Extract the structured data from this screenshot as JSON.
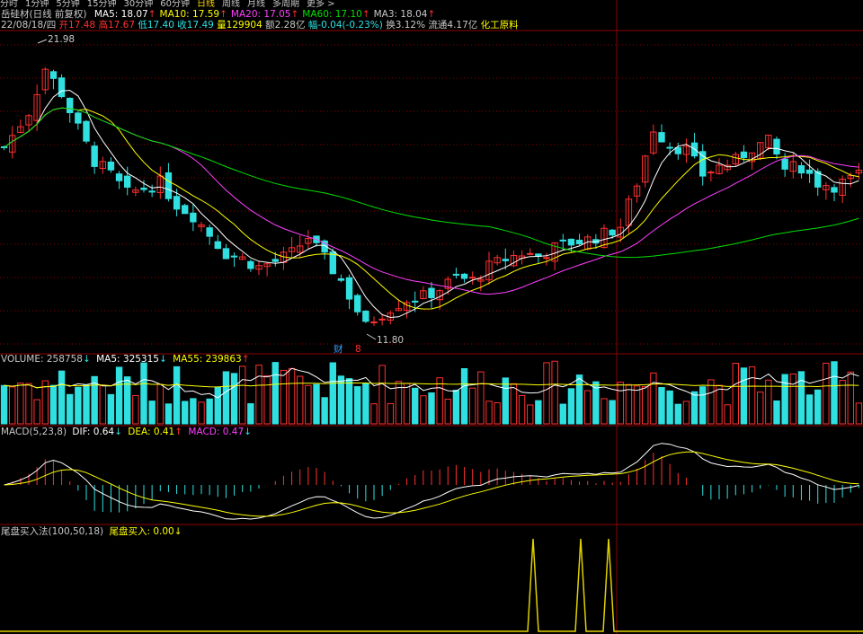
{
  "toolbar": {
    "tabs": [
      "分时",
      "1分钟",
      "5分钟",
      "15分钟",
      "30分钟",
      "60分钟",
      "日线",
      "周线",
      "月线",
      "多周期",
      "更多 >"
    ],
    "active_index": 6
  },
  "header": {
    "stock_title": "岳硅材(日线 前复权)",
    "ma": [
      {
        "label": "MA5: 18.07",
        "arrow": "↑",
        "color": "#ffffff"
      },
      {
        "label": "MA10: 17.59",
        "arrow": "↑",
        "color": "#ffff00"
      },
      {
        "label": "MA20: 17.05",
        "arrow": "↑",
        "color": "#ff40ff"
      },
      {
        "label": "MA60: 17.10",
        "arrow": "↑",
        "color": "#00e000"
      },
      {
        "label": "MA3: 18.04",
        "arrow": "↑",
        "color": "#c8c8c8"
      }
    ]
  },
  "quote": {
    "date": "22/08/18/四",
    "open_label": "开",
    "open": "17.48",
    "high_label": "高",
    "high": "17.67",
    "low_label": "低",
    "low": "17.40",
    "close_label": "收",
    "close": "17.49",
    "vol_label": "量",
    "vol": "129904",
    "amount_label": "额",
    "amount": "2.28亿",
    "change_label": "幅",
    "change": "-0.04(-0.23%)",
    "turnover_label": "换",
    "turnover": "3.12%",
    "float_label": "流通",
    "float": "4.17亿",
    "sector": "化工原料"
  },
  "annotations": {
    "high_price": "21.98",
    "low_price": "11.80",
    "fin_marker": "财",
    "num_marker": "8"
  },
  "volume": {
    "title": "VOLUME: 258758",
    "title_arrow": "↓",
    "ma5": "MA5: 325315",
    "ma5_arrow": "↓",
    "ma55": "MA55: 239863",
    "ma55_arrow": "↑"
  },
  "macd": {
    "title": "MACD(5,23,8)",
    "dif": "DIF: 0.64",
    "dif_arrow": "↓",
    "dea": "DEA: 0.41",
    "dea_arrow": "↑",
    "macd": "MACD: 0.47",
    "macd_arrow": "↓"
  },
  "indicator": {
    "title": "尾盘买入法(100,50,18)",
    "value": "尾盘买入: 0.00",
    "value_arrow": "↓"
  },
  "colors": {
    "up": "#ff3030",
    "down": "#30e0e0",
    "ma5": "#ffffff",
    "ma10": "#ffff00",
    "ma20": "#ff40ff",
    "ma60": "#00e000",
    "grid": "#8b0000"
  }
}
